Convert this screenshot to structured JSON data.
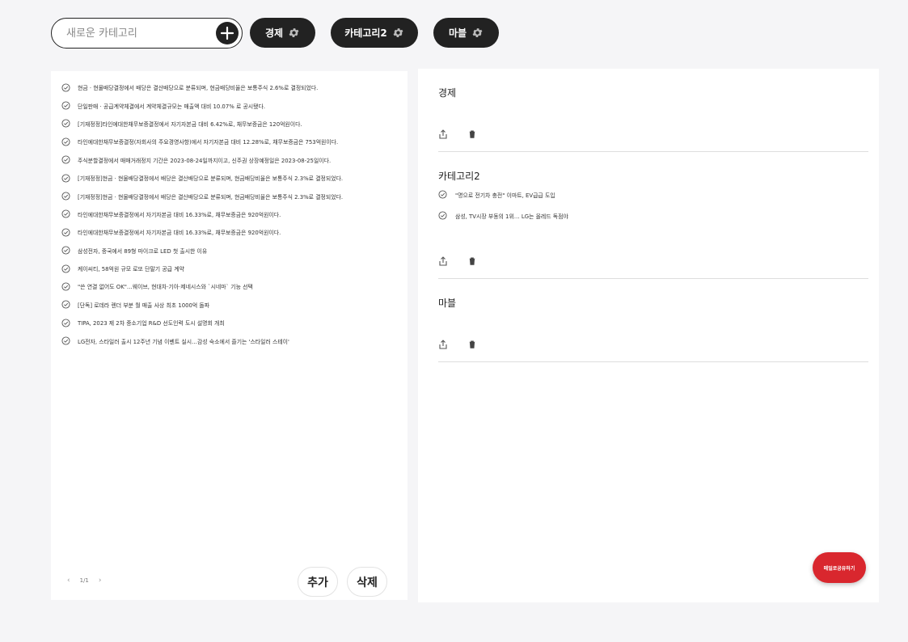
{
  "new_category": {
    "placeholder": "새로운 카테고리"
  },
  "categories": [
    {
      "label": "경제"
    },
    {
      "label": "카테고리2"
    },
    {
      "label": "마블"
    }
  ],
  "news": [
    "현금 · 현물배당결정에서 배당은 결산배당으로 분류되며, 현금배당비율은 보통주식 2.6%로 결정되었다.",
    "단일판매 · 공급계약체결에서 계약체결규모는 매출액 대비 10.07% 로 공시됐다.",
    "[기재정정]타인에대한채무보증결정에서 자기자본금 대비 6.42%로, 채무보증금은 120억원이다.",
    "타인에대한채무보증결정(자회사의 주요경영사항)에서 자기자본금 대비 12.28%로, 채무보증금은 753억원이다.",
    "주식분할결정에서 매매거래정지 기간은 2023-08-24일까지이고, 신주권 상장예정일은 2023-08-25일이다.",
    "[기재정정]현금 · 현물배당결정에서 배당은 결산배당으로 분류되며, 현금배당비율은 보통주식 2.3%로 결정되었다.",
    "[기재정정]현금 · 현물배당결정에서 배당은 결산배당으로 분류되며, 현금배당비율은 보통주식 2.3%로 결정되었다.",
    "타인에대한채무보증결정에서 자기자본금 대비 16.33%로, 채무보증금은 920억원이다.",
    "타인에대한채무보증결정에서 자기자본금 대비 16.33%로, 채무보증금은 920억원이다.",
    "삼성전자, 중국에서 89형 마이크로 LED 첫 출시한 이유",
    "케이씨티, 58억원 규모 로또 단말기 공급 계약",
    "\"쓴 연결 없어도 OK\"…웨이브, 현대차·기아·제네시스와 `시네마` 기능 선택",
    "[단독] 로데라 렌더 부분 월 매출 사상 최초 1000억 돌파",
    "TIPA, 2023 제 2차 중소기업 R&D 선도인력 도시 설명회 개최",
    "LG전자, 스타일러 출시 12주년 기념 이벤트 실시…감성 숙소에서 즐기는 '스타일러 스테이'"
  ],
  "pager": {
    "prev": "‹",
    "text": "1/1",
    "next": "›"
  },
  "buttons": {
    "add": "추가",
    "delete": "삭제"
  },
  "sections": [
    {
      "title": "경제",
      "items": []
    },
    {
      "title": "카테고리2",
      "items": [
        "\"명으로 전기차 충전\" 이마트, EV급급 도입",
        "삼성, TV시장 부동의 1위… LG는 올레드 독점야"
      ]
    },
    {
      "title": "마블",
      "items": []
    }
  ],
  "fab": {
    "label": "메일로공유하기"
  },
  "icons": {
    "add": "plus-icon",
    "gear": "gear-icon",
    "check": "check-circle-icon",
    "share": "share-icon",
    "trash": "trash-icon"
  },
  "colors": {
    "dark": "#222222",
    "accent": "#d9272e",
    "background": "#f5f5f7"
  }
}
